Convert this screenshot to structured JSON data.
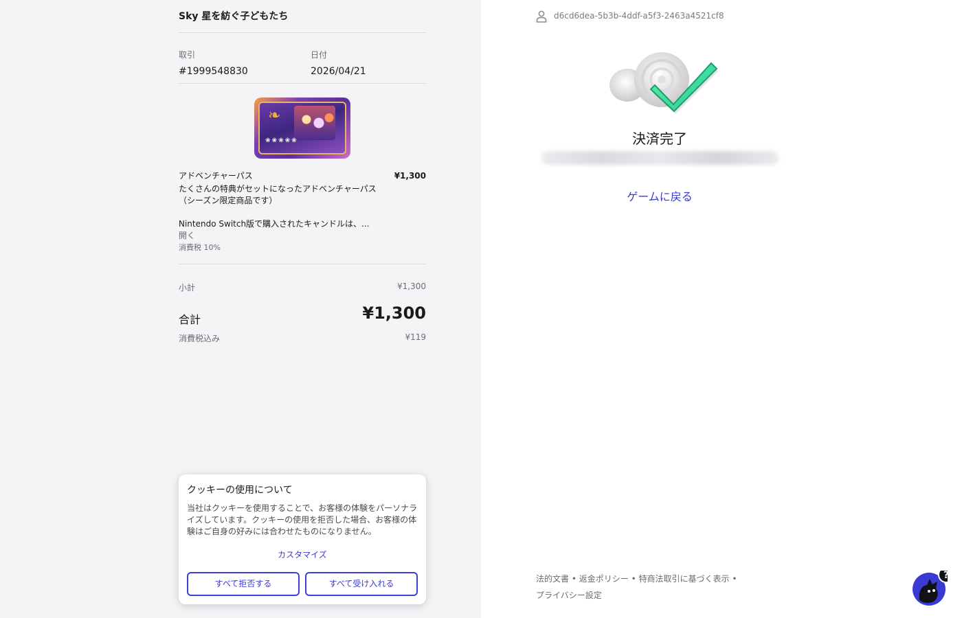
{
  "merchant": {
    "name": "Sky 星を紡ぐ子どもたち"
  },
  "transaction": {
    "id_label": "取引",
    "id_value": "#1999548830",
    "date_label": "日付",
    "date_value": "2026/04/21"
  },
  "item": {
    "name": "アドベンチャーパス",
    "price": "¥1,300",
    "description": "たくさんの特典がセットになったアドベンチャーパス（シーズン限定商品です）",
    "note": "Nintendo Switch版で購入されたキャンドルは、...",
    "open_link": "開く",
    "tax_rate": "消費税 10%"
  },
  "summary": {
    "subtotal_label": "小計",
    "subtotal_value": "¥1,300",
    "total_label": "合計",
    "total_value": "¥1,300",
    "tax_included_label": "消費税込み",
    "tax_included_value": "¥119"
  },
  "cookie_banner": {
    "title": "クッキーの使用について",
    "body": "当社はクッキーを使用することで、お客様の体験をパーソナライズしています。クッキーの使用を拒否した場合、お客様の体験はご自身の好みには合わせたものになりません。",
    "customize": "カスタマイズ",
    "reject_all": "すべて拒否する",
    "accept_all": "すべて受け入れる"
  },
  "user": {
    "id": "d6cd6dea-5b3b-4ddf-a5f3-2463a4521cf8"
  },
  "status": {
    "title": "決済完了",
    "back_link": "ゲームに戻る"
  },
  "footer": {
    "legal": "法的文書",
    "refund": "返金ポリシー",
    "commerce": "特商法取引に基づく表示",
    "privacy": "プライバシー設定",
    "separator": "•"
  },
  "colors": {
    "accent": "#3a3ad0",
    "success": "#3ee6a0",
    "left_bg": "#f4f4f7"
  }
}
